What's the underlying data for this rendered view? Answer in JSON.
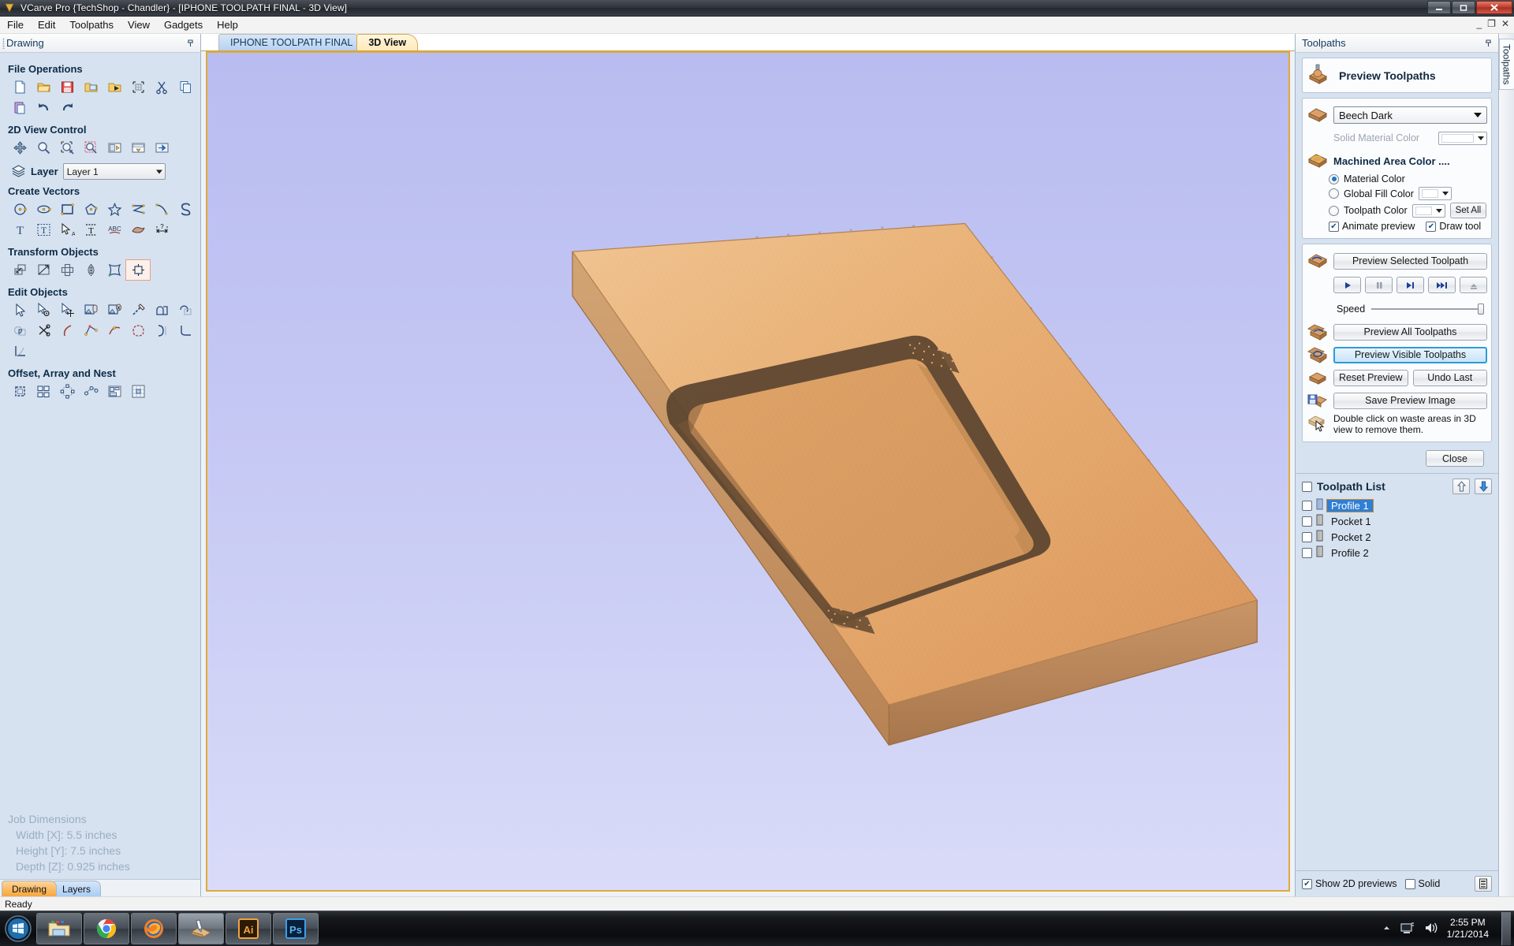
{
  "window": {
    "title": "VCarve Pro {TechShop - Chandler} - [IPHONE TOOLPATH FINAL - 3D View]",
    "minimize": "—",
    "maximize": "❐",
    "close": "✕",
    "mdi_minimize": "_",
    "mdi_restore": "❐",
    "mdi_close": "✕"
  },
  "menu": {
    "items": [
      "File",
      "Edit",
      "Toolpaths",
      "View",
      "Gadgets",
      "Help"
    ]
  },
  "left_panel": {
    "caption": "Drawing",
    "pin_icon": "pin-icon",
    "groups": [
      {
        "title": "File Operations",
        "icons": [
          "new-file-icon",
          "open-folder-icon",
          "save-icon",
          "import-folder-icon",
          "export-folder-icon",
          "job-setup-icon",
          "cut-scissors-icon",
          "copy-icon",
          "paste-icon",
          "undo-icon",
          "redo-icon"
        ]
      },
      {
        "title": "2D View Control",
        "icons": [
          "pan-icon",
          "zoom-icon",
          "zoom-selected-icon",
          "zoom-box-icon",
          "zoom-page-icon",
          "zoom-width-icon",
          "zoom-next-icon"
        ]
      }
    ],
    "layer": {
      "label": "Layer",
      "value": "Layer 1",
      "icon": "layers-icon"
    },
    "create_vectors": {
      "title": "Create Vectors",
      "icons": [
        "circle-icon",
        "ellipse-icon",
        "rectangle-icon",
        "polygon-icon",
        "star-icon",
        "polyline-icon",
        "curve-icon",
        "spiral-icon",
        "text-icon",
        "text-box-icon",
        "text-select-icon",
        "text-on-curve-icon",
        "text-arc-icon",
        "trace-bitmap-icon",
        "dimension-icon"
      ]
    },
    "transform_objects": {
      "title": "Transform Objects",
      "icons": [
        "move-icon",
        "scale-icon",
        "rotate-icon",
        "mirror-icon",
        "distort-icon",
        "align-icon"
      ]
    },
    "edit_objects": {
      "title": "Edit Objects",
      "icons": [
        "node-edit-icon",
        "node-tools-icon",
        "move-nodes-icon",
        "group-icon",
        "ungroup-icon",
        "measure-icon",
        "weld-icon",
        "subtract-icon",
        "intersect-icon",
        "trim-icon",
        "join-icon",
        "curve-fit-icon",
        "smooth-icon",
        "close-vector-icon",
        "offset-open-icon",
        "fillet-icon",
        "fit-curve-icon"
      ]
    },
    "offset_array_nest": {
      "title": "Offset, Array and Nest",
      "icons": [
        "offset-icon",
        "block-copy-icon",
        "circular-copy-icon",
        "copy-along-curve-icon",
        "nest-icon",
        "plate-layout-icon"
      ]
    },
    "job_dimensions": {
      "title": "Job Dimensions",
      "rows": [
        "Width  [X]: 5.5 inches",
        "Height [Y]: 7.5 inches",
        "Depth  [Z]: 0.925 inches"
      ]
    },
    "tabs": [
      {
        "label": "Drawing",
        "active": true
      },
      {
        "label": "Layers",
        "active": false
      }
    ]
  },
  "document_tabs": [
    {
      "label": "IPHONE TOOLPATH FINAL",
      "active": false
    },
    {
      "label": "3D View",
      "active": true
    }
  ],
  "viewport": {
    "background_top": "#b9bdf0",
    "background_bottom": "#d6d8f7",
    "border_color": "#e2a93a",
    "material_top": "#e8a96a",
    "material_top_light": "#f0c08c",
    "material_side": "#c08d5a",
    "material_side_dark": "#a9764a",
    "pocket_color": "#5b4430",
    "pocket_wall": "#8a6442"
  },
  "right_panel": {
    "caption": "Toolpaths",
    "pin_icon": "pin-icon",
    "side_tab": "Toolpaths",
    "header": {
      "title": "Preview Toolpaths",
      "icon": "preview-toolpaths-icon"
    },
    "material": {
      "icon": "material-block-icon",
      "selected": "Beech Dark",
      "solid_material_color_label": "Solid Material Color",
      "solid_material_color_value": "#ffffff",
      "machined_area_label": "Machined Area Color ....",
      "machined_icon": "machined-area-icon",
      "options": [
        {
          "label": "Material Color",
          "selected": true
        },
        {
          "label": "Global Fill Color",
          "selected": false,
          "color": "#ffffff"
        },
        {
          "label": "Toolpath Color",
          "selected": false,
          "color": "#ffffff"
        }
      ],
      "set_all_label": "Set All",
      "animate_preview": {
        "label": "Animate preview",
        "checked": true
      },
      "draw_tool": {
        "label": "Draw tool",
        "checked": true
      }
    },
    "preview": {
      "selected_label": "Preview Selected Toolpath",
      "selected_icon": "preview-selected-icon",
      "transport": [
        {
          "name": "play-button",
          "glyph": "▶",
          "enabled": true
        },
        {
          "name": "pause-button",
          "glyph": "❚❚",
          "enabled": false
        },
        {
          "name": "step-button",
          "glyph": "▶❙",
          "enabled": true
        },
        {
          "name": "fast-forward-button",
          "glyph": "▶▶❙",
          "enabled": true
        },
        {
          "name": "reset-button",
          "glyph": "⤒",
          "enabled": false
        }
      ],
      "speed_label": "Speed",
      "speed_value": 100,
      "all_label": "Preview All Toolpaths",
      "all_icon": "preview-all-icon",
      "visible_label": "Preview Visible Toolpaths",
      "visible_icon": "preview-visible-icon",
      "reset_label": "Reset Preview",
      "reset_icon": "reset-preview-icon",
      "undo_label": "Undo Last",
      "save_label": "Save Preview Image",
      "save_icon": "save-preview-icon",
      "hint_icon": "waste-area-icon",
      "hint": "Double click on waste areas in 3D view to remove them.",
      "close_label": "Close"
    },
    "toolpath_list": {
      "title": "Toolpath List",
      "header_checkbox": false,
      "move_up_icon": "arrow-up-icon",
      "move_down_icon": "arrow-down-icon",
      "items": [
        {
          "label": "Profile 1",
          "checked": false,
          "selected": true,
          "icon": "toolpath-icon"
        },
        {
          "label": "Pocket 1",
          "checked": false,
          "selected": false,
          "icon": "toolpath-icon"
        },
        {
          "label": "Pocket 2",
          "checked": false,
          "selected": false,
          "icon": "toolpath-icon"
        },
        {
          "label": "Profile 2",
          "checked": false,
          "selected": false,
          "icon": "toolpath-icon"
        }
      ],
      "footer": {
        "show_2d_previews": {
          "label": "Show 2D previews",
          "checked": true
        },
        "solid": {
          "label": "Solid",
          "checked": false
        },
        "list_button_icon": "list-view-icon"
      }
    }
  },
  "status_bar": {
    "text": "Ready"
  },
  "taskbar": {
    "start_icon": "windows-start-icon",
    "items": [
      {
        "name": "file-explorer-icon",
        "label": "",
        "active": false
      },
      {
        "name": "chrome-icon",
        "label": "",
        "active": false
      },
      {
        "name": "firefox-icon",
        "label": "",
        "active": false
      },
      {
        "name": "vcarve-icon",
        "label": "",
        "active": true
      },
      {
        "name": "illustrator-icon",
        "label": "Ai",
        "active": false
      },
      {
        "name": "photoshop-icon",
        "label": "Ps",
        "active": false
      }
    ],
    "tray": {
      "show_hidden_icon": "chevron-up-icon",
      "network_icon": "network-icon",
      "volume_icon": "volume-icon",
      "time": "2:55 PM",
      "date": "1/21/2014"
    }
  }
}
